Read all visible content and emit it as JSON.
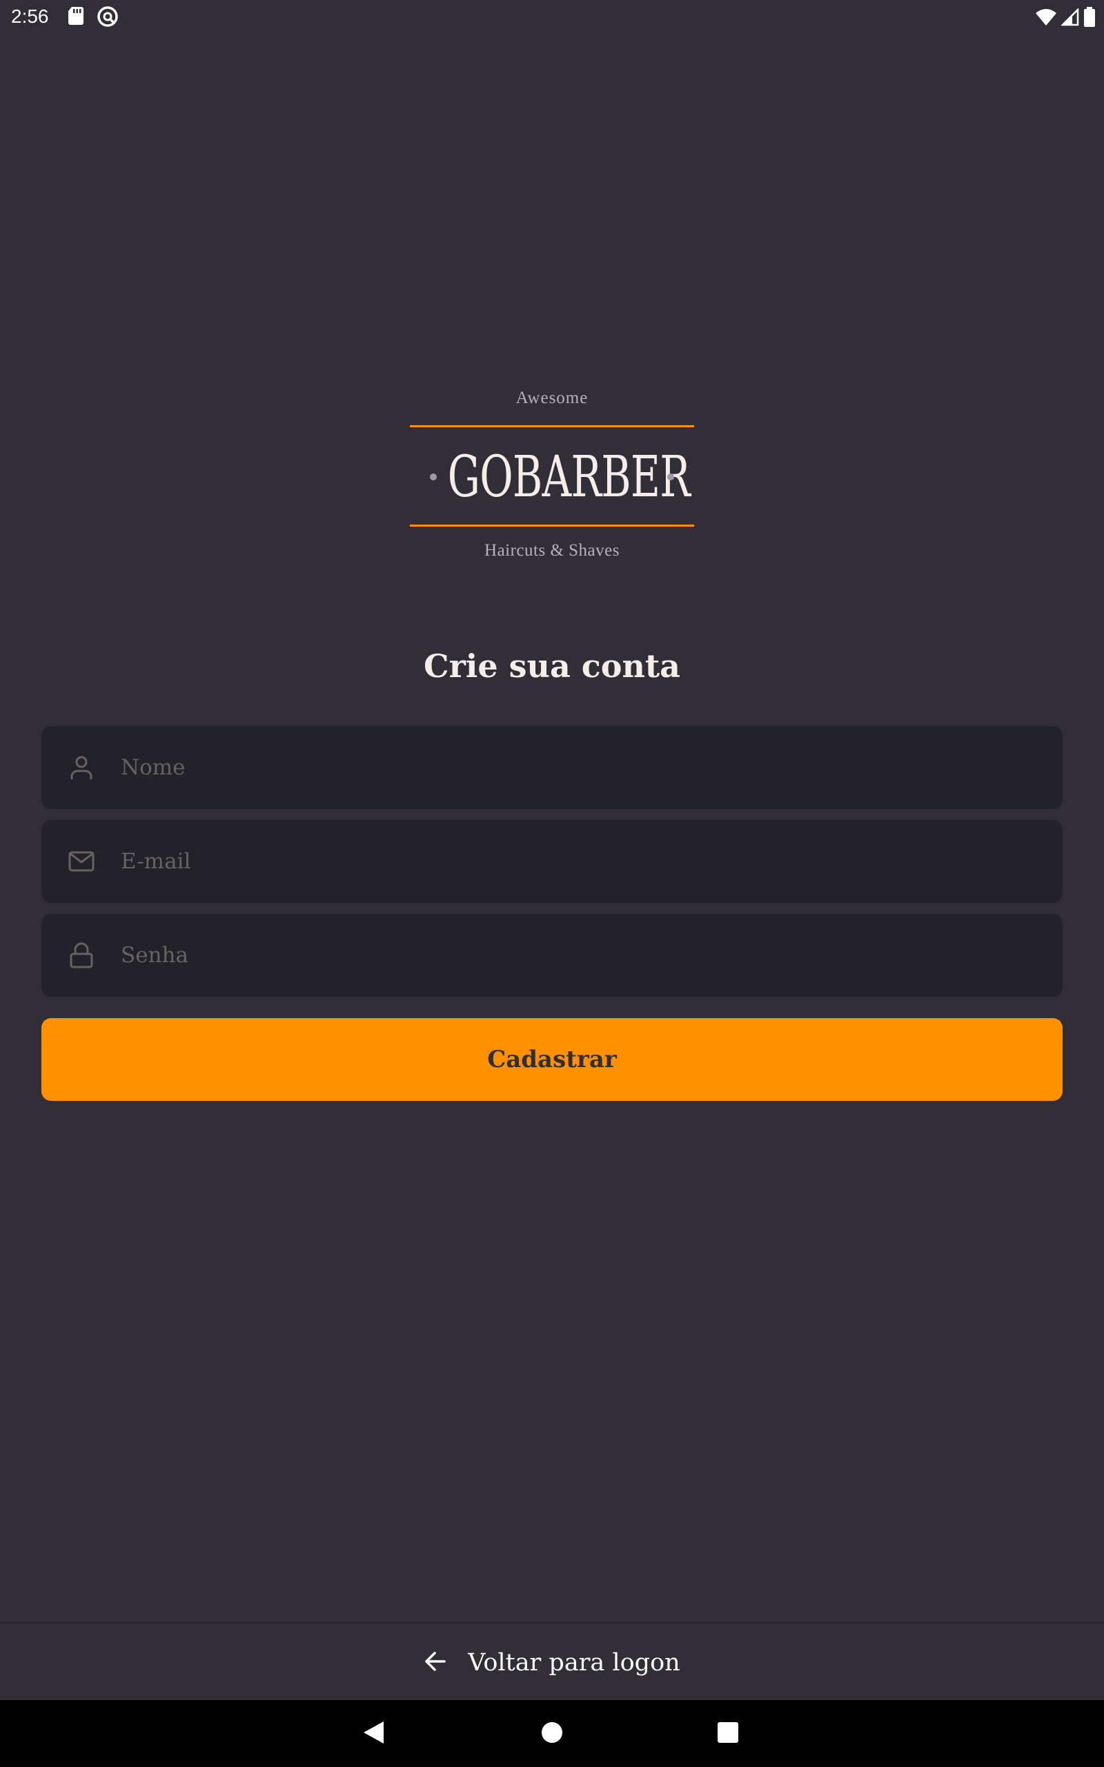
{
  "status_bar": {
    "time": "2:56",
    "left_icons": [
      "sd-card-icon",
      "vpn-key-icon"
    ],
    "right_icons": [
      "wifi-icon",
      "signal-icon",
      "battery-icon"
    ]
  },
  "logo": {
    "top_text": "Awesome",
    "wordmark": "GOBARBER",
    "tagline": "Haircuts & Shaves",
    "accent_color": "#ff9000"
  },
  "form": {
    "title": "Crie sua conta",
    "fields": [
      {
        "icon": "user-icon",
        "placeholder": "Nome",
        "value": ""
      },
      {
        "icon": "mail-icon",
        "placeholder": "E-mail",
        "value": ""
      },
      {
        "icon": "lock-icon",
        "placeholder": "Senha",
        "value": ""
      }
    ],
    "submit_label": "Cadastrar"
  },
  "footer": {
    "icon": "arrow-left-icon",
    "label": "Voltar para logon"
  },
  "nav_bar": {
    "buttons": [
      "back-icon",
      "home-icon",
      "recents-icon"
    ]
  },
  "colors": {
    "background": "#312e38",
    "input_background": "#232129",
    "primary": "#ff9000",
    "text": "#f4ede8",
    "placeholder": "#666360"
  }
}
